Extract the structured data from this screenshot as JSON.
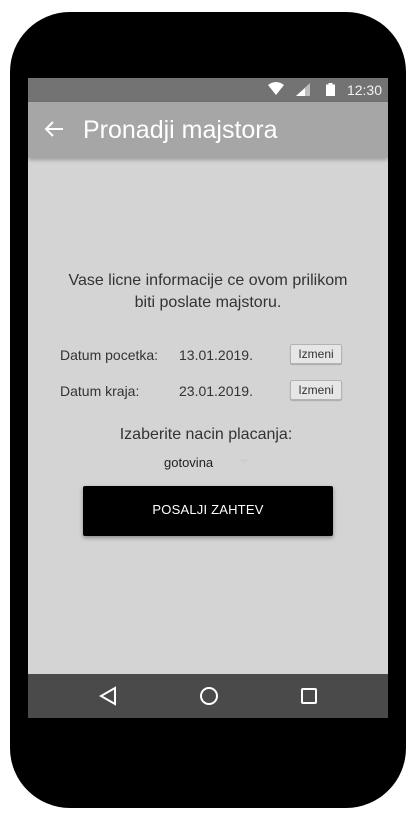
{
  "status_bar": {
    "time": "12:30"
  },
  "app_bar": {
    "title": "Pronadji majstora",
    "back_icon": "arrow-left-icon"
  },
  "main": {
    "info_text": "Vase licne informacije ce ovom prilikom biti poslate majstoru.",
    "start_date": {
      "label": "Datum pocetka:",
      "value": "13.01.2019.",
      "button": "Izmeni"
    },
    "end_date": {
      "label": "Datum kraja:",
      "value": "23.01.2019.",
      "button": "Izmeni"
    },
    "payment": {
      "label": "Izaberite nacin placanja:",
      "selected": "gotovina"
    },
    "submit_label": "POSALJI ZAHTEV"
  },
  "nav_bar": {
    "icons": [
      "back-triangle-icon",
      "home-circle-icon",
      "recents-square-icon"
    ]
  },
  "colors": {
    "app_bar": "#a6a6a6",
    "status_bar": "#737373",
    "background": "#d4d4d4",
    "nav_bar": "#4a4a4a",
    "button": "#000000"
  }
}
